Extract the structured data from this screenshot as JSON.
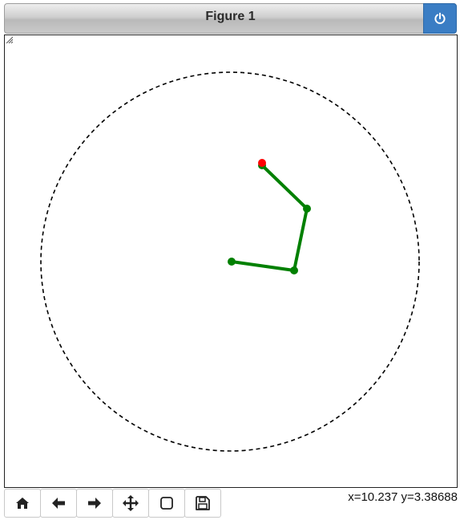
{
  "window": {
    "title": "Figure 1"
  },
  "toolbar": {
    "buttons": [
      {
        "icon": "home-icon",
        "label": "Home"
      },
      {
        "icon": "arrow-left-icon",
        "label": "Back"
      },
      {
        "icon": "arrow-right-icon",
        "label": "Forward"
      },
      {
        "icon": "move-icon",
        "label": "Pan"
      },
      {
        "icon": "square-icon",
        "label": "Zoom"
      },
      {
        "icon": "save-icon",
        "label": "Save"
      }
    ]
  },
  "status": {
    "coordinates": "x=10.237 y=3.38688"
  },
  "colors": {
    "arm": "#008000",
    "end_effector": "#ff0000",
    "boundary": "#000000",
    "power_button": "#3a7dc4"
  }
}
